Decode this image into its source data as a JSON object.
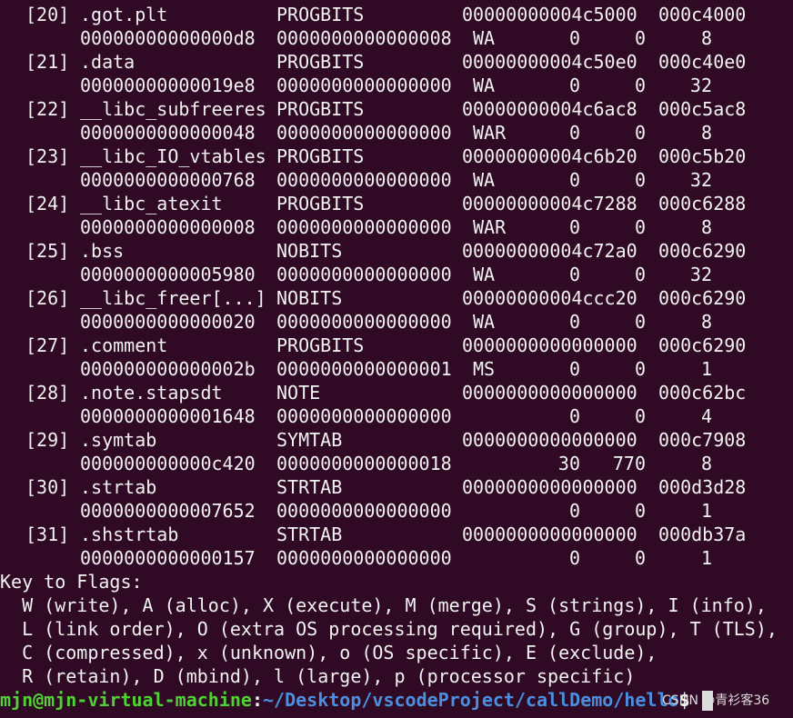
{
  "terminal": {
    "sections": [
      {
        "index": "[20]",
        "name": ".got.plt",
        "type": "PROGBITS",
        "address": "00000000004c5000",
        "offset": "000c4000",
        "size": "00000000000000d8",
        "entsize": "0000000000000008",
        "flags": "WA",
        "link": "0",
        "info": "0",
        "align": "8"
      },
      {
        "index": "[21]",
        "name": ".data",
        "type": "PROGBITS",
        "address": "00000000004c50e0",
        "offset": "000c40e0",
        "size": "00000000000019e8",
        "entsize": "0000000000000000",
        "flags": "WA",
        "link": "0",
        "info": "0",
        "align": "32"
      },
      {
        "index": "[22]",
        "name": "__libc_subfreeres",
        "type": "PROGBITS",
        "address": "00000000004c6ac8",
        "offset": "000c5ac8",
        "size": "0000000000000048",
        "entsize": "0000000000000000",
        "flags": "WAR",
        "link": "0",
        "info": "0",
        "align": "8"
      },
      {
        "index": "[23]",
        "name": "__libc_IO_vtables",
        "type": "PROGBITS",
        "address": "00000000004c6b20",
        "offset": "000c5b20",
        "size": "0000000000000768",
        "entsize": "0000000000000000",
        "flags": "WA",
        "link": "0",
        "info": "0",
        "align": "32"
      },
      {
        "index": "[24]",
        "name": "__libc_atexit",
        "type": "PROGBITS",
        "address": "00000000004c7288",
        "offset": "000c6288",
        "size": "0000000000000008",
        "entsize": "0000000000000000",
        "flags": "WAR",
        "link": "0",
        "info": "0",
        "align": "8"
      },
      {
        "index": "[25]",
        "name": ".bss",
        "type": "NOBITS",
        "address": "00000000004c72a0",
        "offset": "000c6290",
        "size": "0000000000005980",
        "entsize": "0000000000000000",
        "flags": "WA",
        "link": "0",
        "info": "0",
        "align": "32"
      },
      {
        "index": "[26]",
        "name": "__libc_freer[...]",
        "type": "NOBITS",
        "address": "00000000004ccc20",
        "offset": "000c6290",
        "size": "0000000000000020",
        "entsize": "0000000000000000",
        "flags": "WA",
        "link": "0",
        "info": "0",
        "align": "8"
      },
      {
        "index": "[27]",
        "name": ".comment",
        "type": "PROGBITS",
        "address": "0000000000000000",
        "offset": "000c6290",
        "size": "000000000000002b",
        "entsize": "0000000000000001",
        "flags": "MS",
        "link": "0",
        "info": "0",
        "align": "1"
      },
      {
        "index": "[28]",
        "name": ".note.stapsdt",
        "type": "NOTE",
        "address": "0000000000000000",
        "offset": "000c62bc",
        "size": "0000000000001648",
        "entsize": "0000000000000000",
        "flags": "",
        "link": "0",
        "info": "0",
        "align": "4"
      },
      {
        "index": "[29]",
        "name": ".symtab",
        "type": "SYMTAB",
        "address": "0000000000000000",
        "offset": "000c7908",
        "size": "000000000000c420",
        "entsize": "0000000000000018",
        "flags": "",
        "link": "30",
        "info": "770",
        "align": "8"
      },
      {
        "index": "[30]",
        "name": ".strtab",
        "type": "STRTAB",
        "address": "0000000000000000",
        "offset": "000d3d28",
        "size": "0000000000007652",
        "entsize": "0000000000000000",
        "flags": "",
        "link": "0",
        "info": "0",
        "align": "1"
      },
      {
        "index": "[31]",
        "name": ".shstrtab",
        "type": "STRTAB",
        "address": "0000000000000000",
        "offset": "000db37a",
        "size": "0000000000000157",
        "entsize": "0000000000000000",
        "flags": "",
        "link": "0",
        "info": "0",
        "align": "1"
      }
    ],
    "key_to_flags": {
      "heading": "Key to Flags:",
      "lines": [
        "  W (write), A (alloc), X (execute), M (merge), S (strings), I (info),",
        "  L (link order), O (extra OS processing required), G (group), T (TLS),",
        "  C (compressed), x (unknown), o (OS specific), E (exclude),",
        "  R (retain), D (mbind), l (large), p (processor specific)"
      ]
    },
    "prompt": {
      "user_host": "mjn@mjn-virtual-machine",
      "separator": ":",
      "path": "~/Desktop/vscodeProject/callDemo/hello",
      "symbol": "$"
    },
    "watermark": "CSDN @青衫客36"
  }
}
